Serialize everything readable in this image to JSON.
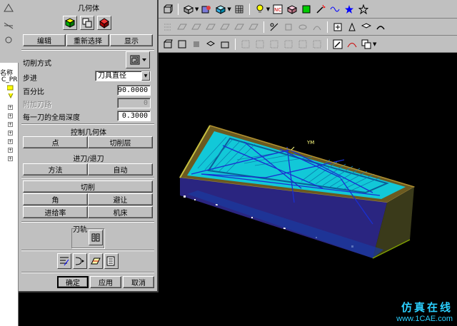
{
  "dialog": {
    "geometry_title": "几何体",
    "geometry_buttons": {
      "edit": "编辑",
      "reselect": "重新选择",
      "display": "显示"
    },
    "cut_method_label": "切削方式",
    "stepover": {
      "label": "步进",
      "value": "刀具直径"
    },
    "percent": {
      "label": "百分比",
      "value": "90.0000"
    },
    "extra_passes": {
      "label": "附加刀路",
      "value": "0"
    },
    "global_depth": {
      "label": "每一刀的全局深度",
      "value": "0.3000"
    },
    "control_geometry": {
      "title": "控制几何体",
      "point": "点",
      "cut_levels": "切削层"
    },
    "engage_retract": {
      "title": "进刀/退刀",
      "method": "方法",
      "auto": "自动"
    },
    "cutting": {
      "cut": "切削",
      "corner": "角",
      "avoid": "避让",
      "feed_rate": "进给率",
      "machine": "机床"
    },
    "toolpath": {
      "title": "刀轨"
    },
    "footer": {
      "ok": "确定",
      "apply": "应用",
      "cancel": "取消"
    }
  },
  "tree": {
    "name_label": "名称",
    "row1": "C_PR"
  },
  "viewport": {
    "axis_label": "YM"
  },
  "watermark": {
    "line1": "仿真在线",
    "line2": "www.1CAE.com"
  },
  "icons": [
    "geometry-icon",
    "cut-pattern-icon",
    "toolpath-generate-icon",
    "toolpath-replay-icon"
  ]
}
